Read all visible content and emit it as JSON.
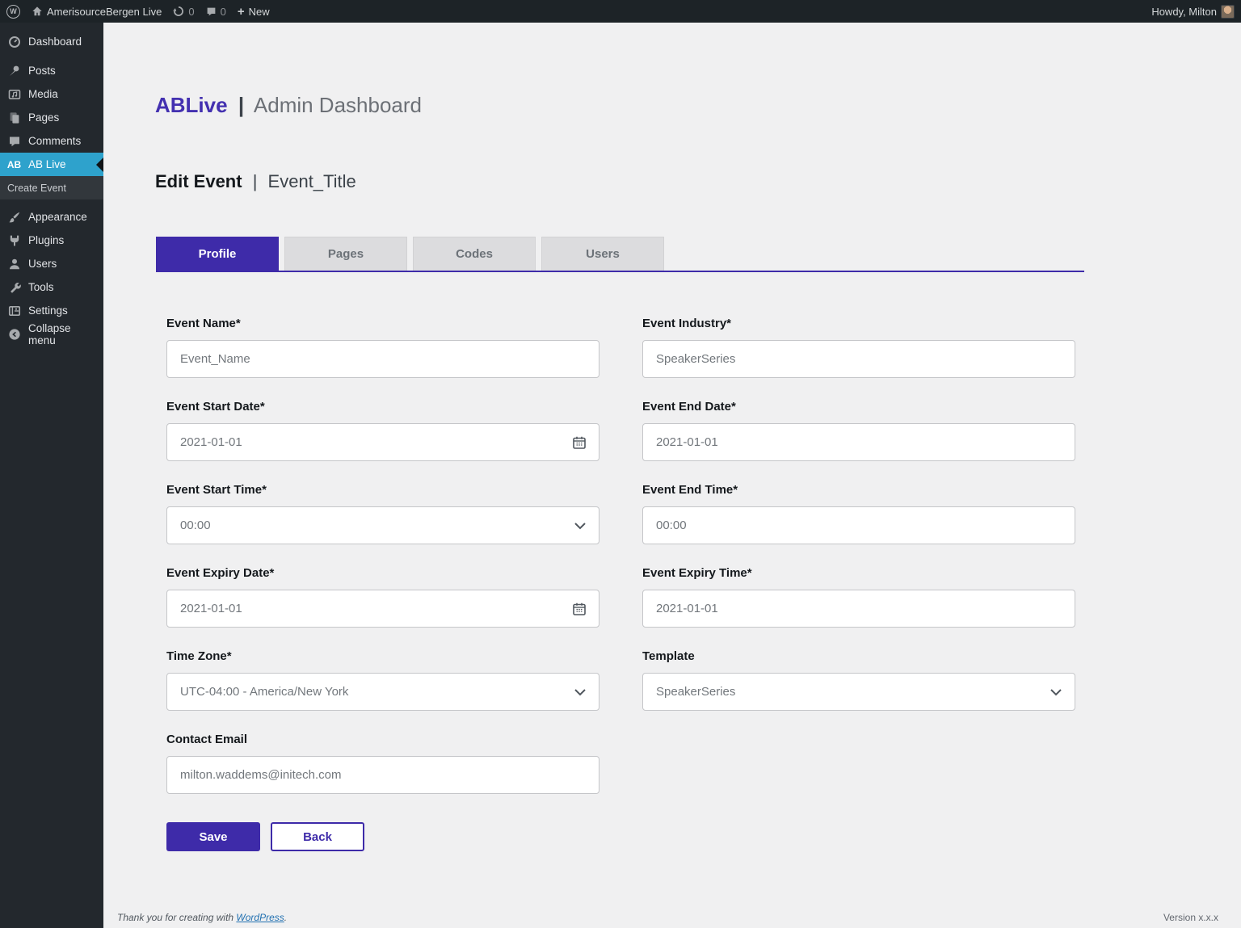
{
  "admin_bar": {
    "site_name": "AmerisourceBergen Live",
    "update_count": "0",
    "comment_count": "0",
    "new_label": "New",
    "howdy_text": "Howdy, Milton"
  },
  "sidebar": {
    "items": [
      {
        "label": "Dashboard"
      },
      {
        "label": "Posts"
      },
      {
        "label": "Media"
      },
      {
        "label": "Pages"
      },
      {
        "label": "Comments"
      },
      {
        "label": "AB Live",
        "icon_text": "AB"
      },
      {
        "label": "Create Event"
      },
      {
        "label": "Appearance"
      },
      {
        "label": "Plugins"
      },
      {
        "label": "Users"
      },
      {
        "label": "Tools"
      },
      {
        "label": "Settings"
      },
      {
        "label": "Collapse menu"
      }
    ]
  },
  "header": {
    "brand": "ABLive",
    "separator": "|",
    "subtitle": "Admin Dashboard"
  },
  "page_title": {
    "title": "Edit Event",
    "separator": "|",
    "subtitle": "Event_Title"
  },
  "tabs": [
    {
      "label": "Profile",
      "active": true
    },
    {
      "label": "Pages",
      "active": false
    },
    {
      "label": "Codes",
      "active": false
    },
    {
      "label": "Users",
      "active": false
    }
  ],
  "form": {
    "event_name": {
      "label": "Event Name*",
      "value": "Event_Name"
    },
    "event_industry": {
      "label": "Event Industry*",
      "value": "SpeakerSeries"
    },
    "event_start_date": {
      "label": "Event Start Date*",
      "value": "2021-01-01"
    },
    "event_end_date": {
      "label": "Event End Date*",
      "value": "2021-01-01"
    },
    "event_start_time": {
      "label": "Event Start Time*",
      "value": "00:00"
    },
    "event_end_time": {
      "label": "Event End Time*",
      "value": "00:00"
    },
    "event_expiry_date": {
      "label": "Event Expiry Date*",
      "value": "2021-01-01"
    },
    "event_expiry_time": {
      "label": "Event Expiry Time*",
      "value": "2021-01-01"
    },
    "time_zone": {
      "label": "Time Zone*",
      "value": "UTC-04:00 - America/New York"
    },
    "template": {
      "label": "Template",
      "value": "SpeakerSeries"
    },
    "contact_email": {
      "label": "Contact Email",
      "value": "milton.waddems@initech.com"
    }
  },
  "actions": {
    "save": "Save",
    "back": "Back"
  },
  "footer": {
    "thanks_prefix": "Thank you for creating with",
    "wordpress_link": "WordPress",
    "thanks_suffix": ".",
    "version": "Version x.x.x"
  },
  "colors": {
    "accent_purple": "#3e2ba9",
    "sidebar_active_blue": "#2ea2cc",
    "link_blue": "#2271b1",
    "admin_dark": "#1d2327",
    "sidebar_dark": "#23282d",
    "content_bg": "#f0f0f1"
  }
}
